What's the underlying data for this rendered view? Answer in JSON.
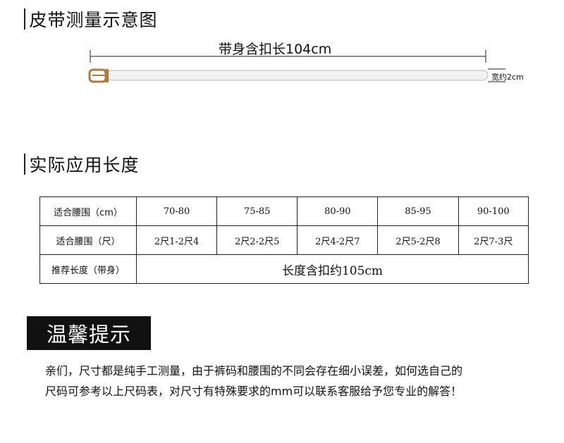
{
  "section1": {
    "title": "皮带测量示意图"
  },
  "diagram": {
    "length_label": "带身含扣长104cm",
    "width_label": "宽约2cm"
  },
  "section2": {
    "title": "实际应用长度"
  },
  "table": {
    "rows": [
      {
        "header": "适合腰围（cm）",
        "cells": [
          "70-80",
          "75-85",
          "80-90",
          "85-95",
          "90-100"
        ]
      },
      {
        "header": "适合腰围（尺）",
        "cells": [
          "2尺1-2尺4",
          "2尺2-2尺5",
          "2尺4-2尺7",
          "2尺5-2尺8",
          "2尺7-3尺"
        ]
      }
    ],
    "recommend": {
      "header": "推荐长度（带身）",
      "value": "长度含扣约105cm"
    }
  },
  "tips": {
    "title": "温馨提示",
    "line1": "亲们，尺寸都是纯手工测量，由于裤码和腰围的不同会存在细小误差，如何选自己的",
    "line2": "尺码可参考以上尺码表，对尺寸有特殊要求的mm可以联系客服给予您专业的解答！"
  },
  "colors": {
    "buckle": "#b07a3a",
    "belt": "#f2f2f2",
    "tips_bg": "#111111"
  }
}
